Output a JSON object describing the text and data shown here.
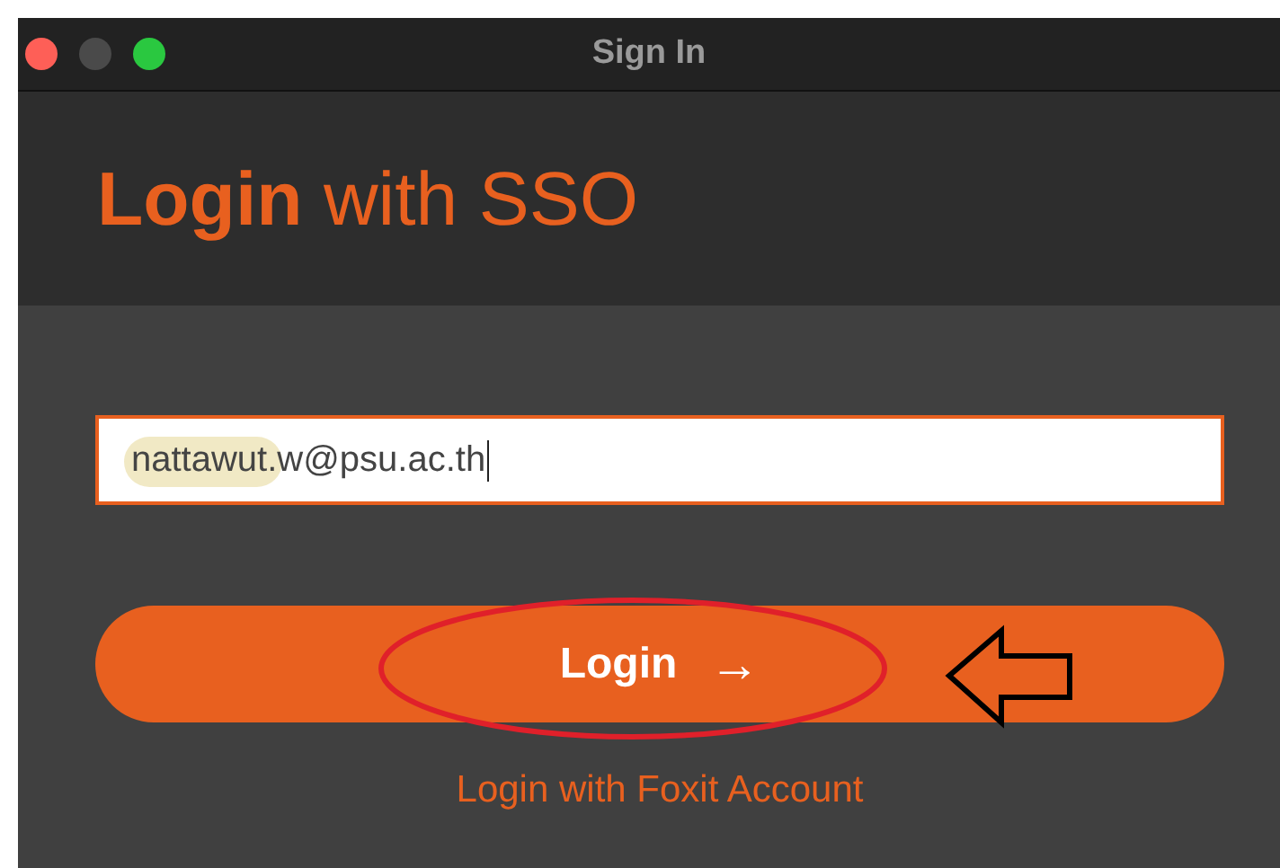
{
  "window": {
    "title": "Sign In"
  },
  "heading": "**Login** with SSO",
  "email_field": {
    "value": "nattawut.w@psu.ac.th"
  },
  "login_button": {
    "label": "Login",
    "arrow": "→"
  },
  "alt_link": "Login with Foxit Account"
}
